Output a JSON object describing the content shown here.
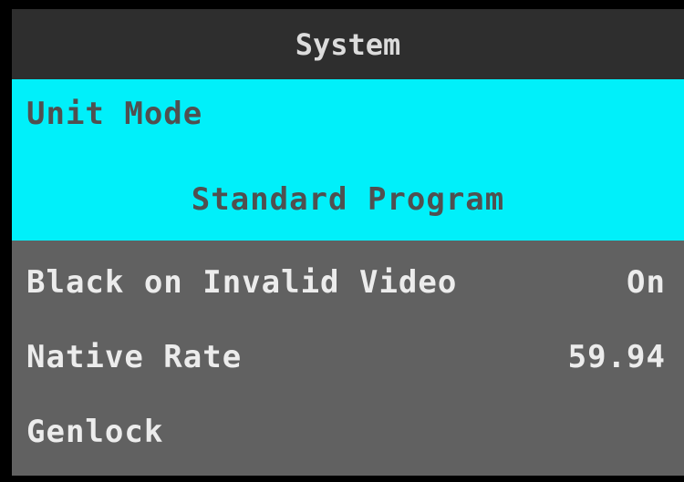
{
  "header": {
    "title": "System"
  },
  "selected": {
    "label": "Unit Mode",
    "value": "Standard Program"
  },
  "rows": [
    {
      "label": "Black on Invalid Video",
      "value": "On"
    },
    {
      "label": "Native Rate",
      "value": "59.94"
    },
    {
      "label": "Genlock",
      "value": ""
    }
  ],
  "colors": {
    "header_bg": "#2e2e2e",
    "selected_bg": "#00f0fa",
    "list_bg": "#616161",
    "text_light": "#ececec",
    "text_dark": "#505050"
  }
}
